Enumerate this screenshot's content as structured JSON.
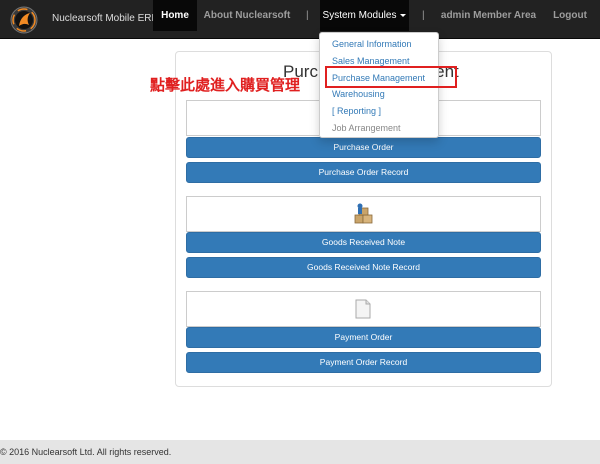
{
  "navbar": {
    "brand": "Nuclearsoft Mobile ERP",
    "home": "Home",
    "about": "About Nuclearsoft",
    "modules": "System Modules",
    "member": "admin Member Area",
    "logout": "Logout",
    "separator": "|"
  },
  "dropdown": {
    "items": [
      "General Information",
      "Sales Management",
      "Purchase Management",
      "Warehousing",
      "[ Reporting ]",
      "Job Arrangement"
    ]
  },
  "annotation": "點擊此處進入購買管理",
  "panel": {
    "title": "Purchase Management",
    "buttons": [
      "Purchase Order",
      "Purchase Order Record",
      "Goods Received Note",
      "Goods Received Note Record",
      "Payment Order",
      "Payment Order Record"
    ]
  },
  "footer": {
    "copyright": "© 2016 Nuclearsoft Ltd. All rights reserved."
  },
  "colors": {
    "navbar": "#222222",
    "button": "#337ab7",
    "annotation": "#e02020",
    "link": "#337ab7"
  },
  "icons": [
    "logo-icon",
    "order-icon",
    "boxes-icon",
    "document-icon",
    "caret-down-icon"
  ]
}
